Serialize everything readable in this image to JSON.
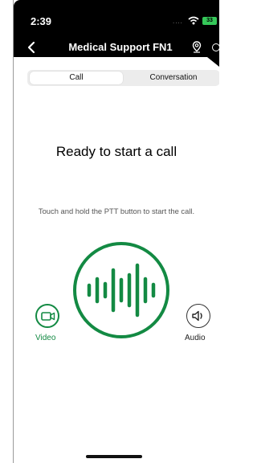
{
  "status_bar": {
    "time": "2:39",
    "signal_dots": "....",
    "wifi_icon": "wifi-icon",
    "battery_level": "33"
  },
  "header": {
    "title": "Medical Support FN1",
    "back_icon": "chevron-left-icon",
    "location_icon": "location-pin-icon",
    "more_icon": "circle-icon"
  },
  "tabs": [
    {
      "label": "Call",
      "selected": true
    },
    {
      "label": "Conversation",
      "selected": false
    }
  ],
  "main": {
    "status_text": "Ready to start a call",
    "hint_text": "Touch and hold the PTT button to start the call.",
    "ptt_icon": "audio-waveform-icon",
    "video_label": "Video",
    "audio_label": "Audio"
  },
  "colors": {
    "accent": "#138a43",
    "header_bg": "#000000",
    "battery": "#35c759"
  }
}
